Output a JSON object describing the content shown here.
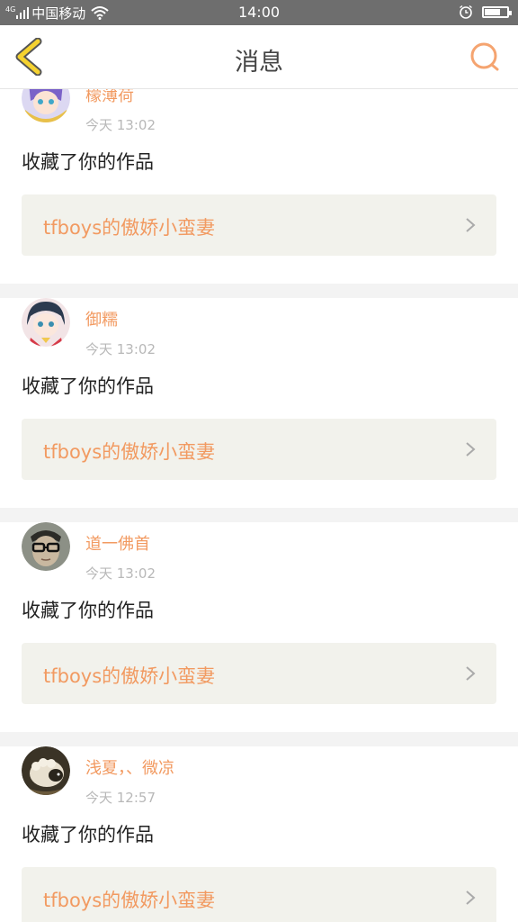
{
  "status_bar": {
    "network": "4G",
    "carrier": "中国移动",
    "time": "14:00",
    "battery_level": 0.75
  },
  "header": {
    "title": "消息"
  },
  "notifications": [
    {
      "username": "檬薄荷",
      "time": "今天  13:02",
      "action": "收藏了你的作品",
      "work_title": "tfboys的傲娇小蛮妻"
    },
    {
      "username": "御糯",
      "time": "今天  13:02",
      "action": "收藏了你的作品",
      "work_title": "tfboys的傲娇小蛮妻"
    },
    {
      "username": "道一佛首",
      "time": "今天  13:02",
      "action": "收藏了你的作品",
      "work_title": "tfboys的傲娇小蛮妻"
    },
    {
      "username": "浅夏，、微凉",
      "time": "今天  12:57",
      "action": "收藏了你的作品",
      "work_title": "tfboys的傲娇小蛮妻"
    }
  ],
  "colors": {
    "accent": "#f29a61",
    "back_icon": "#f5d230",
    "search_icon": "#f5a470"
  }
}
